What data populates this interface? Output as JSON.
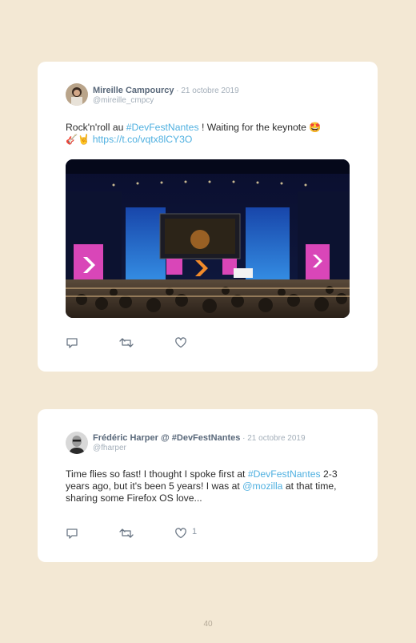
{
  "tweets": [
    {
      "author": "Mireille Campourcy",
      "date": " · 21 octobre 2019",
      "handle": "@mireille_cmpcy",
      "text_before": "Rock'n'roll au ",
      "hashtag": "#DevFestNantes",
      "text_after": " ! Waiting for the keynote 🤩",
      "emoji_line": "🎸🤘 ",
      "url": "https://t.co/vqtx8lCY3O",
      "image_alt": "Conference keynote hall"
    },
    {
      "author": "Frédéric Harper @ #DevFestNantes",
      "date": " · 21 octobre 2019",
      "handle": "@fharper",
      "text_part1": "Time flies so fast! I thought I spoke first at ",
      "hashtag": "#DevFestNantes",
      "text_part2": " 2-3 years ago, but it's been 5 years! I was at ",
      "mention": "@mozilla",
      "text_part3": " at that time, sharing some Firefox OS love...",
      "like_count": "1"
    }
  ],
  "page_number": "40",
  "icons": [
    "reply-icon",
    "retweet-icon",
    "like-icon"
  ],
  "colors": {
    "background": "#f3e8d4",
    "link": "#4fb0e0",
    "name": "#59687a"
  }
}
